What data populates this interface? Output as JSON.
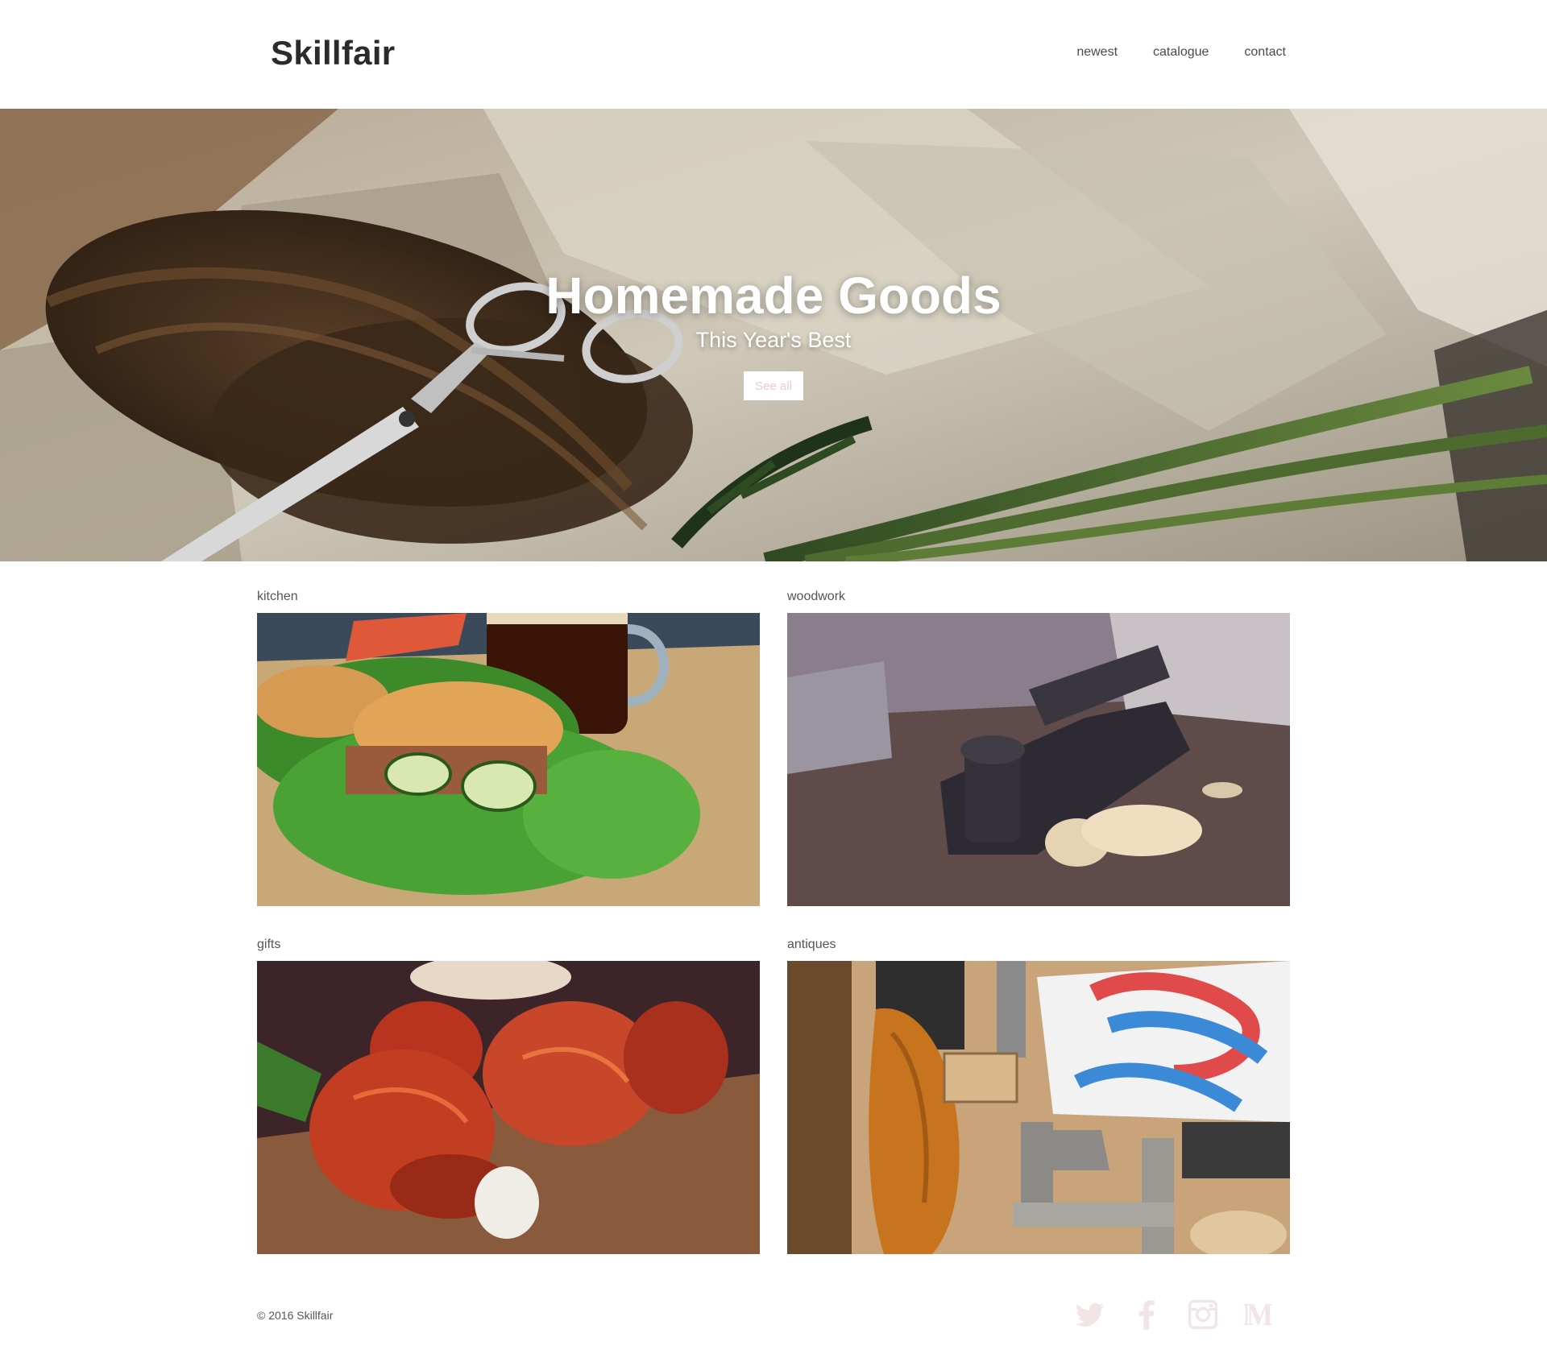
{
  "header": {
    "logo": "Skillfair",
    "nav": [
      "newest",
      "catalogue",
      "contact"
    ]
  },
  "hero": {
    "title": "Homemade Goods",
    "subtitle": "This Year's Best",
    "button_label": "See all",
    "image": "scissors-twine-paper-photo"
  },
  "categories": [
    {
      "label": "kitchen",
      "image": "sandwich-beer-photo"
    },
    {
      "label": "woodwork",
      "image": "wood-plane-shavings-photo"
    },
    {
      "label": "gifts",
      "image": "red-tulips-photo"
    },
    {
      "label": "antiques",
      "image": "letterpress-tools-photo"
    }
  ],
  "footer": {
    "copyright": "© 2016 Skillfair",
    "social": [
      "twitter-icon",
      "facebook-icon",
      "instagram-icon",
      "medium-icon"
    ],
    "icon_color": "#f3e4e6"
  },
  "colors": {
    "logo": "#2b2b2b",
    "button_text": "#f2c8cc",
    "hero_text": "#ffffff"
  }
}
